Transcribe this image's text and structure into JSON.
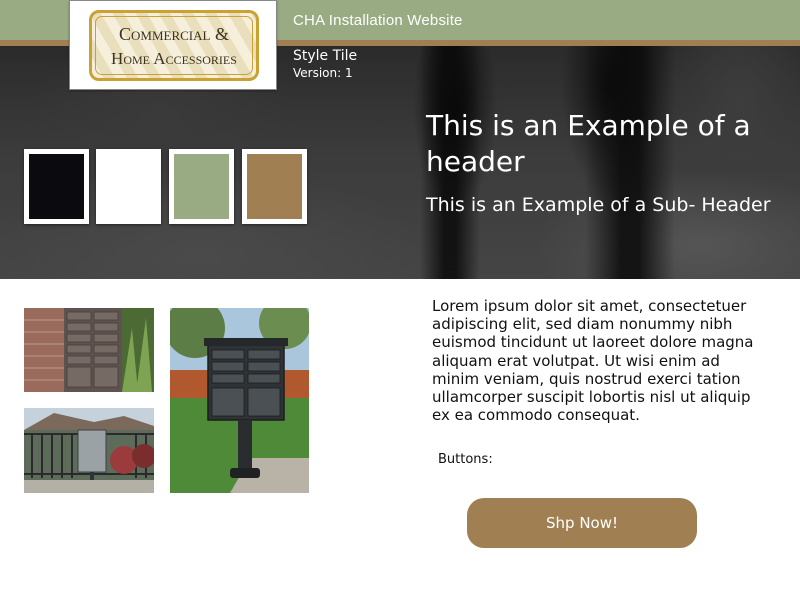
{
  "header": {
    "site_title": "CHA Installation Website",
    "logo": {
      "line1": "Commercial &",
      "line2": "Home Accessories"
    }
  },
  "style_tile": {
    "title": "Style Tile",
    "version": "Version: 1"
  },
  "swatches": [
    {
      "name": "black",
      "color": "#0b0b0f"
    },
    {
      "name": "white",
      "color": "#ffffff"
    },
    {
      "name": "sage-green",
      "color": "#98ab83"
    },
    {
      "name": "brown",
      "color": "#a07f52"
    }
  ],
  "hero": {
    "header": "This is an Example of a header",
    "subheader": "This is an Example of a Sub- Header"
  },
  "body": {
    "paragraph": "Lorem ipsum dolor sit amet, consectetuer adipiscing elit, sed diam nonummy nibh euismod tincidunt ut laoreet dolore magna aliquam erat volutpat. Ut wisi enim ad minim veniam, quis nostrud exerci tation ullamcorper suscipit lobortis nisl ut aliquip ex ea commodo consequat.",
    "buttons_label": "Buttons:",
    "shop_button": "Shp Now!"
  },
  "colors": {
    "topbar": "#98ab83",
    "accent": "#a07f52"
  }
}
